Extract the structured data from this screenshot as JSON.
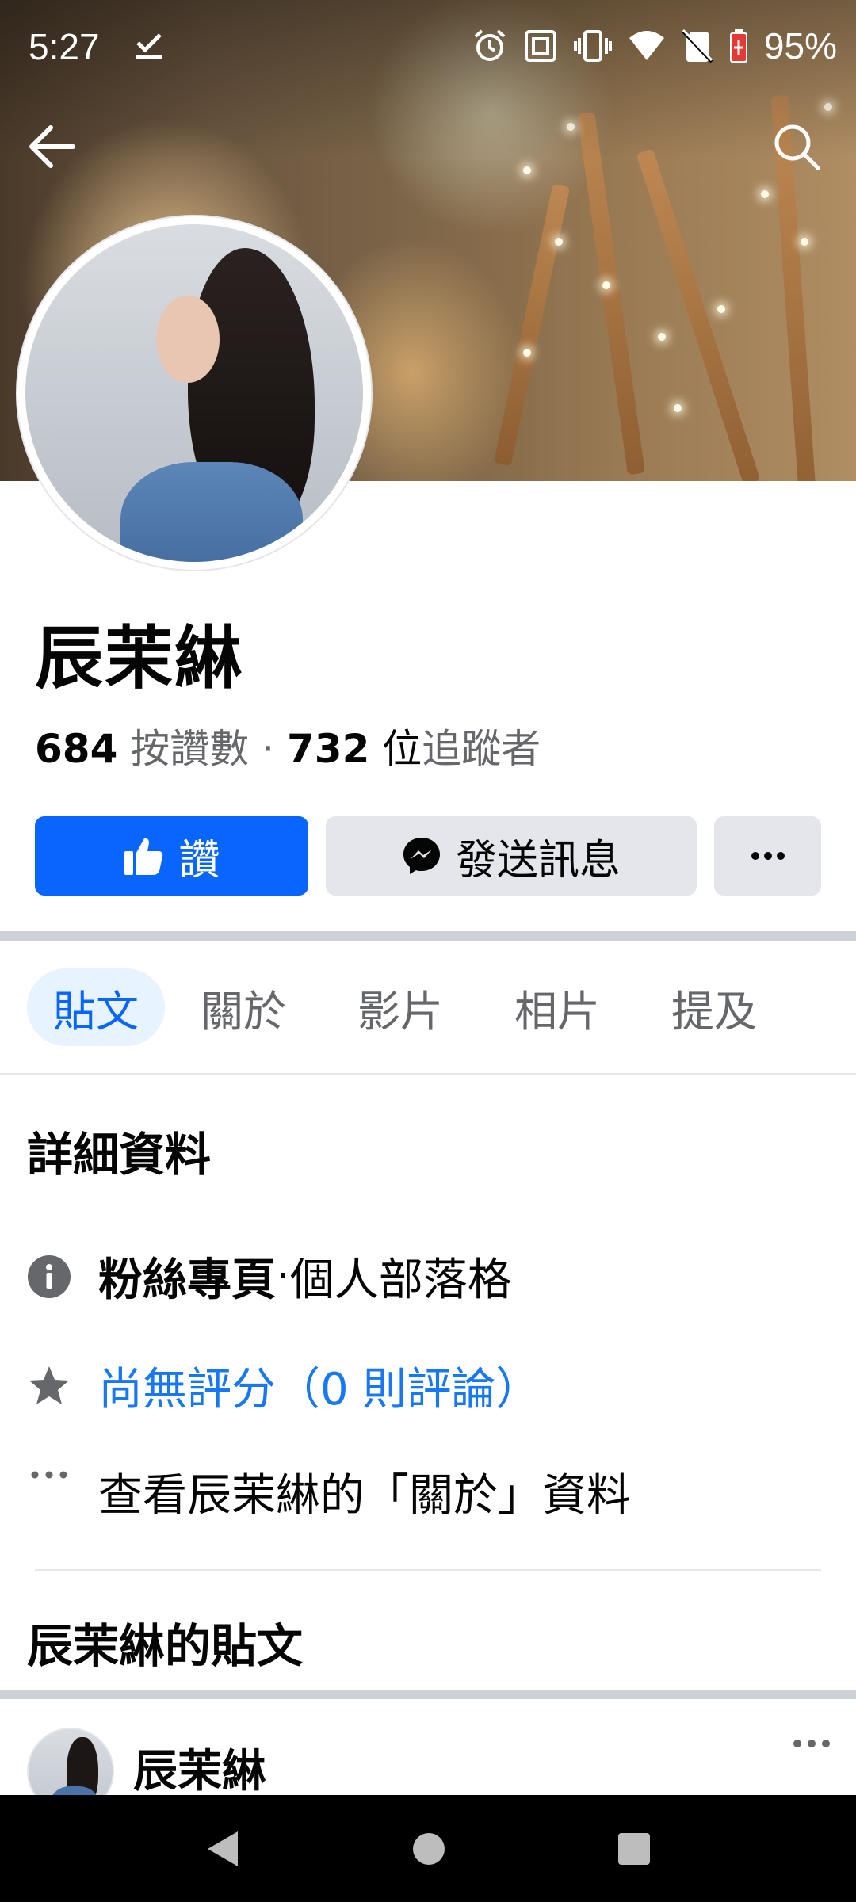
{
  "status_bar": {
    "time": "5:27",
    "battery_percent": "95%",
    "icons": [
      "check-icon",
      "alarm-icon",
      "nfc-icon",
      "vibrate-icon",
      "wifi-icon",
      "no-sim-icon",
      "battery-icon"
    ]
  },
  "header": {
    "back_icon": "arrow-left-icon",
    "search_icon": "search-icon"
  },
  "profile": {
    "name": "辰茉綝",
    "likes_count": "684",
    "likes_label": "按讚數",
    "dot": "·",
    "followers_count": "732",
    "followers_unit": "位",
    "followers_label": "追蹤者"
  },
  "actions": {
    "like_label": "讚",
    "message_label": "發送訊息",
    "more_icon": "more-horizontal-icon"
  },
  "tabs": [
    {
      "label": "貼文",
      "active": true
    },
    {
      "label": "關於",
      "active": false
    },
    {
      "label": "影片",
      "active": false
    },
    {
      "label": "相片",
      "active": false
    },
    {
      "label": "提及",
      "active": false
    }
  ],
  "details": {
    "title": "詳細資料",
    "page_type_bold": "粉絲專頁",
    "page_type_sep": " · ",
    "page_type_category": "個人部落格",
    "rating": "尚無評分（0 則評論）",
    "about_link": "查看辰茉綝的「關於」資料"
  },
  "posts": {
    "title": "辰茉綝的貼文",
    "first_author": "辰茉綝"
  },
  "colors": {
    "brand_blue": "#0866ff",
    "link_blue": "#1877f2",
    "secondary_text": "#65676b",
    "button_gray": "#e4e6eb"
  }
}
